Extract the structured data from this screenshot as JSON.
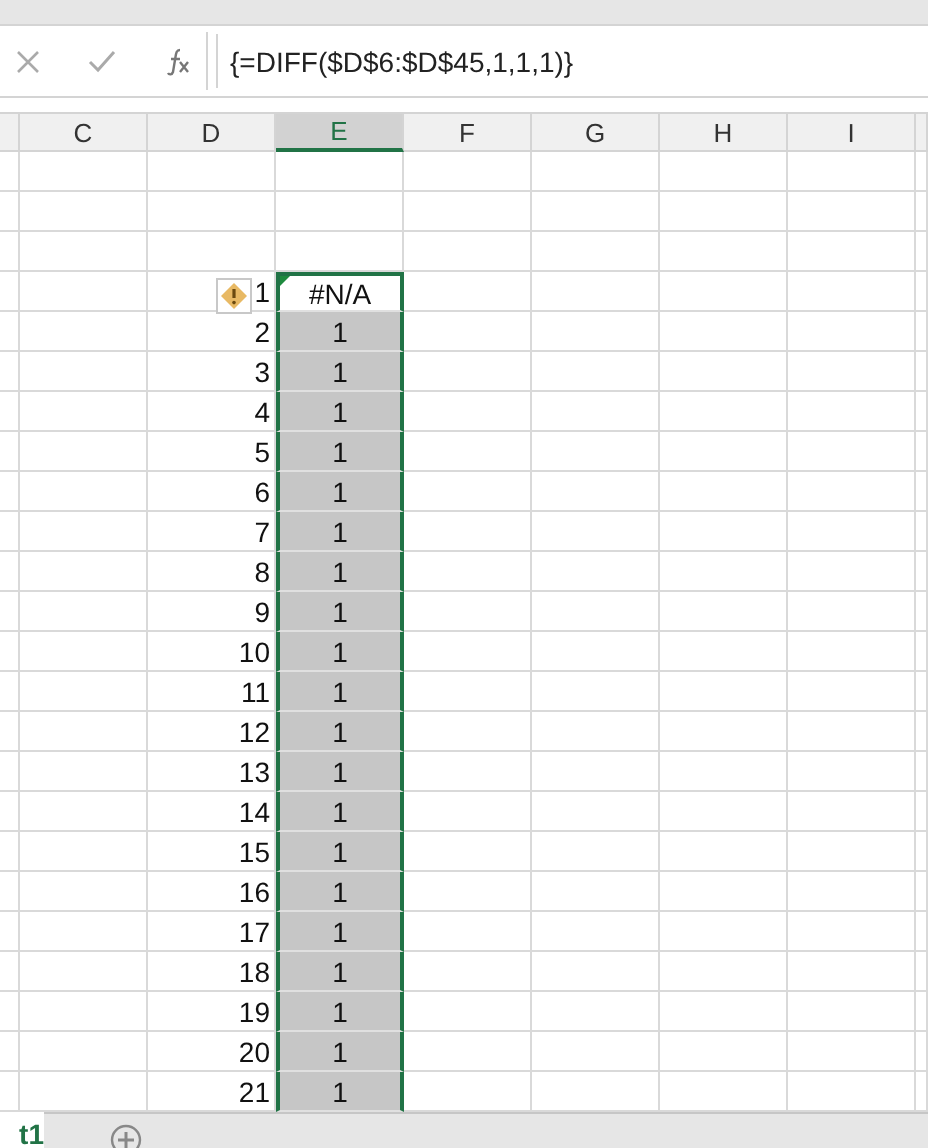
{
  "formula_bar": {
    "formula": "{=DIFF($D$6:$D$45,1,1,1)}"
  },
  "columns": [
    {
      "label": "C",
      "selected": false
    },
    {
      "label": "D",
      "selected": false
    },
    {
      "label": "E",
      "selected": true
    },
    {
      "label": "F",
      "selected": false
    },
    {
      "label": "G",
      "selected": false
    },
    {
      "label": "H",
      "selected": false
    },
    {
      "label": "I",
      "selected": false
    }
  ],
  "rows": [
    {
      "column_d": "1",
      "column_e": "#N/A",
      "selected": true,
      "active": true,
      "warning": true
    },
    {
      "column_d": "2",
      "column_e": "1",
      "selected": true,
      "active": false,
      "warning": false
    },
    {
      "column_d": "3",
      "column_e": "1",
      "selected": true,
      "active": false,
      "warning": false
    },
    {
      "column_d": "4",
      "column_e": "1",
      "selected": true,
      "active": false,
      "warning": false
    },
    {
      "column_d": "5",
      "column_e": "1",
      "selected": true,
      "active": false,
      "warning": false
    },
    {
      "column_d": "6",
      "column_e": "1",
      "selected": true,
      "active": false,
      "warning": false
    },
    {
      "column_d": "7",
      "column_e": "1",
      "selected": true,
      "active": false,
      "warning": false
    },
    {
      "column_d": "8",
      "column_e": "1",
      "selected": true,
      "active": false,
      "warning": false
    },
    {
      "column_d": "9",
      "column_e": "1",
      "selected": true,
      "active": false,
      "warning": false
    },
    {
      "column_d": "10",
      "column_e": "1",
      "selected": true,
      "active": false,
      "warning": false
    },
    {
      "column_d": "11",
      "column_e": "1",
      "selected": true,
      "active": false,
      "warning": false
    },
    {
      "column_d": "12",
      "column_e": "1",
      "selected": true,
      "active": false,
      "warning": false
    },
    {
      "column_d": "13",
      "column_e": "1",
      "selected": true,
      "active": false,
      "warning": false
    },
    {
      "column_d": "14",
      "column_e": "1",
      "selected": true,
      "active": false,
      "warning": false
    },
    {
      "column_d": "15",
      "column_e": "1",
      "selected": true,
      "active": false,
      "warning": false
    },
    {
      "column_d": "16",
      "column_e": "1",
      "selected": true,
      "active": false,
      "warning": false
    },
    {
      "column_d": "17",
      "column_e": "1",
      "selected": true,
      "active": false,
      "warning": false
    },
    {
      "column_d": "18",
      "column_e": "1",
      "selected": true,
      "active": false,
      "warning": false
    },
    {
      "column_d": "19",
      "column_e": "1",
      "selected": true,
      "active": false,
      "warning": false
    },
    {
      "column_d": "20",
      "column_e": "1",
      "selected": true,
      "active": false,
      "warning": false
    },
    {
      "column_d": "21",
      "column_e": "1",
      "selected": true,
      "active": false,
      "warning": false
    }
  ],
  "sheet_tabs": [
    {
      "label": "t1",
      "selected": true
    }
  ]
}
